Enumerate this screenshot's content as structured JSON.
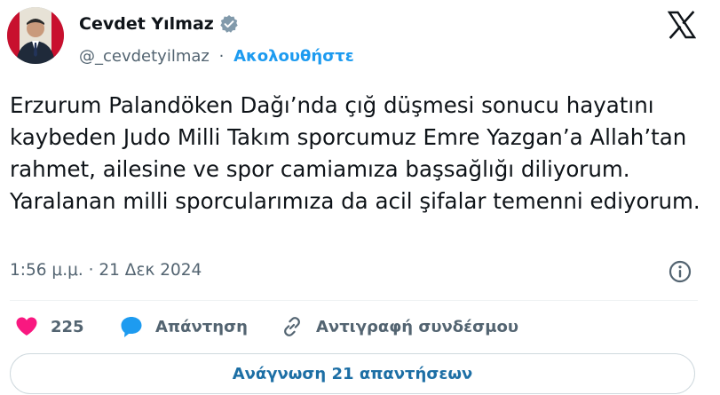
{
  "author": {
    "display_name": "Cevdet Yılmaz",
    "handle": "@_cevdetyilmaz",
    "separator": "·",
    "follow_label": "Ακολουθήστε",
    "verified_icon": "verified-badge-gray"
  },
  "tweet": {
    "text": "Erzurum Palandöken Dağı’nda çığ düşmesi sonucu hayatını kaybeden Judo Milli Takım sporcumuz Emre Yazgan’a Allah’tan rahmet, ailesine ve spor camiamıza başsağlığı diliyorum. Yaralanan milli sporcularımıza da acil şifalar temenni ediyorum.",
    "timestamp": "1:56 μ.μ. · 21 Δεκ 2024"
  },
  "actions": {
    "like_count": "225",
    "reply_label": "Απάντηση",
    "copy_link_label": "Αντιγραφή συνδέσμου"
  },
  "footer": {
    "read_replies_label": "Ανάγνωση 21 απαντήσεων"
  },
  "colors": {
    "accent": "#1d9bf0",
    "like": "#f91880",
    "muted": "#536471",
    "text": "#0f1419"
  }
}
